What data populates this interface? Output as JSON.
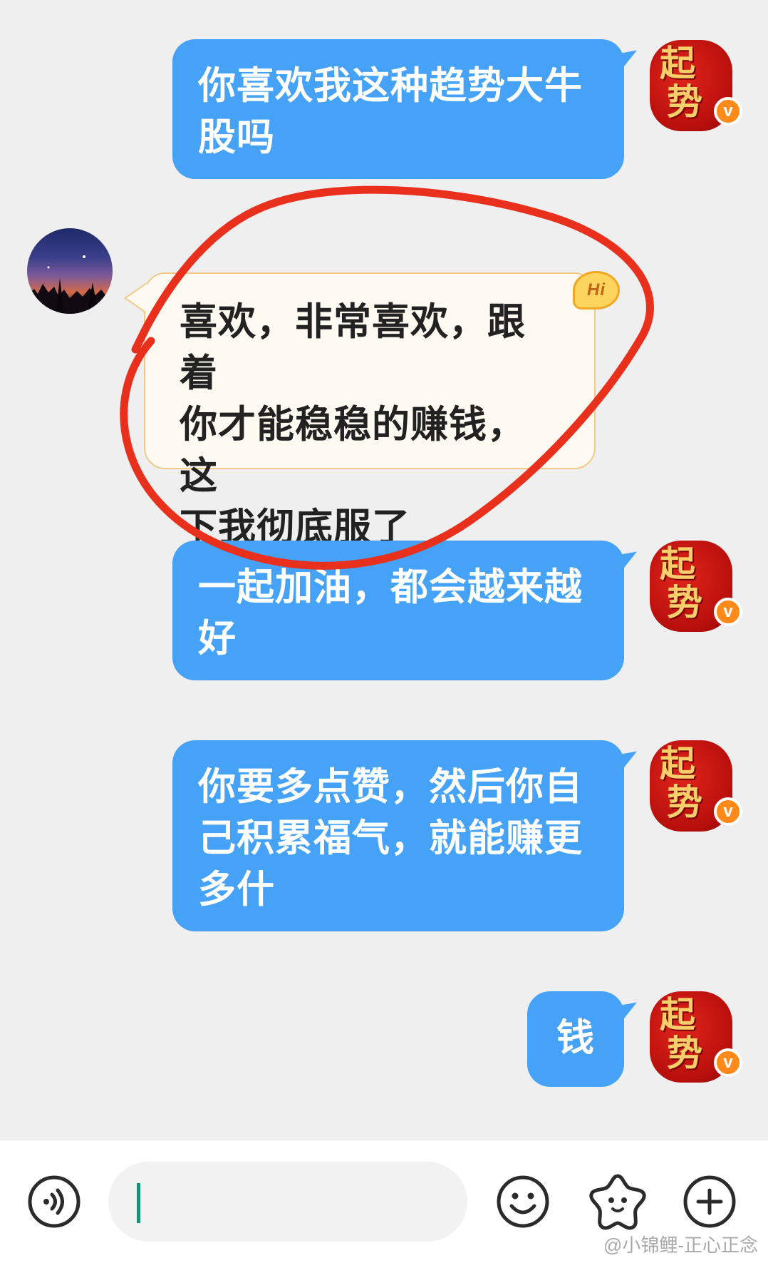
{
  "messages": [
    {
      "side": "out",
      "text_line1": "你喜欢我这种趋势大牛",
      "text_line2": "股吗"
    },
    {
      "side": "in",
      "text_line1": "喜欢，非常喜欢，跟着",
      "text_line2": "你才能稳稳的赚钱，这",
      "text_line3": "下我彻底服了",
      "badge": "Hi"
    },
    {
      "side": "out",
      "text_line1": "一起加油，都会越来越",
      "text_line2": "好"
    },
    {
      "side": "out",
      "text_line1": "你要多点赞，然后你自",
      "text_line2": "己积累福气，就能赚更",
      "text_line3": "多什"
    },
    {
      "side": "out",
      "text_line1": "钱"
    }
  ],
  "brand_avatar": {
    "glyph1": "起",
    "glyph2": "势",
    "verified": "v"
  },
  "input_bar": {
    "voice_icon": "voice-icon",
    "emoji_icon": "emoji-icon",
    "sticker_icon": "sticker-icon",
    "plus_icon": "plus-icon",
    "input_value": ""
  },
  "watermark": "@小锦鲤-正心正念",
  "colors": {
    "outgoing_bubble": "#46a2f7",
    "incoming_bubble": "#fefaf1",
    "annotation": "#e8301c",
    "background": "#efefef"
  }
}
